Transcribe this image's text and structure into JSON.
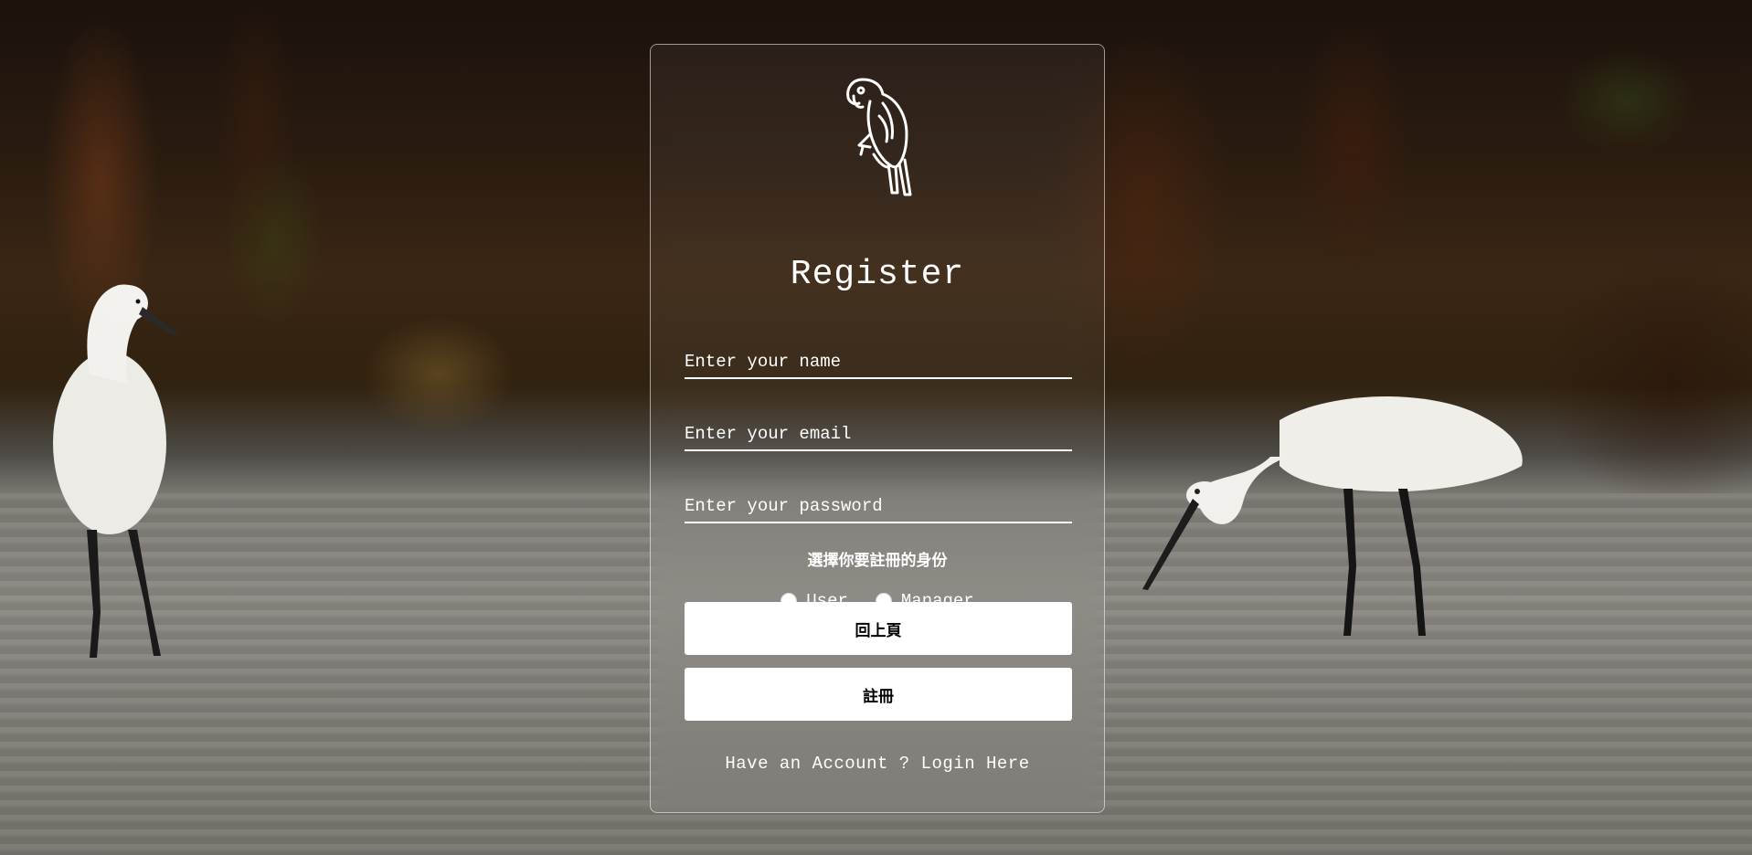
{
  "form": {
    "title": "Register",
    "name_placeholder": "Enter your name",
    "email_placeholder": "Enter your email",
    "password_placeholder": "Enter your password",
    "role_prompt": "選擇你要註冊的身份",
    "roles": [
      {
        "label": "User",
        "selected": false
      },
      {
        "label": "Manager",
        "selected": false
      }
    ],
    "back_button": "回上頁",
    "register_button": "註冊",
    "login_link": "Have an Account ? Login Here"
  },
  "icons": {
    "logo": "parrot-icon"
  },
  "colors": {
    "text": "#ffffff",
    "button_bg": "#ffffff",
    "button_text": "#000000"
  }
}
